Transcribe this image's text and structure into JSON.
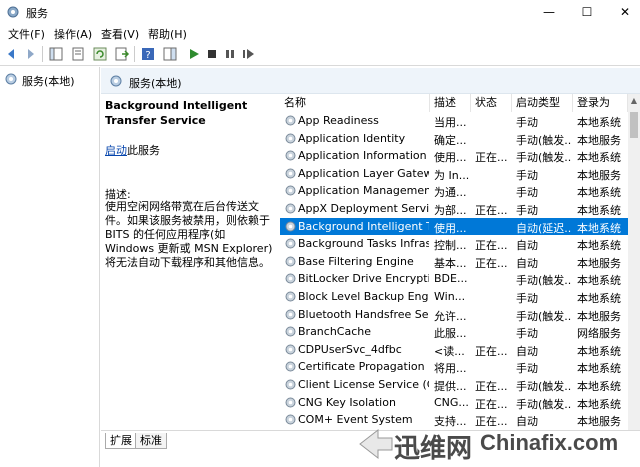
{
  "window": {
    "title": "服务",
    "minimize": "—",
    "maximize": "☐",
    "close": "✕"
  },
  "menu": [
    "文件(F)",
    "操作(A)",
    "查看(V)",
    "帮助(H)"
  ],
  "tree": {
    "root_label": "服务(本地)"
  },
  "pane": {
    "header": "服务(本地)"
  },
  "description": {
    "service_name": "Background Intelligent Transfer Service",
    "start_link": "启动",
    "start_suffix": "此服务",
    "label": "描述:",
    "text": "使用空闲网络带宽在后台传送文件。如果该服务被禁用，则依赖于 BITS 的任何应用程序(如 Windows 更新或 MSN Explorer)将无法自动下载程序和其他信息。"
  },
  "columns": [
    "名称",
    "描述",
    "状态",
    "启动类型",
    "登录为"
  ],
  "services": [
    {
      "name": "App Readiness",
      "desc": "当用...",
      "status": "",
      "startup": "手动",
      "logon": "本地系统"
    },
    {
      "name": "Application Identity",
      "desc": "确定...",
      "status": "",
      "startup": "手动(触发...",
      "logon": "本地服务"
    },
    {
      "name": "Application Information",
      "desc": "使用...",
      "status": "正在...",
      "startup": "手动(触发...",
      "logon": "本地系统"
    },
    {
      "name": "Application Layer Gatewa...",
      "desc": "为 In...",
      "status": "",
      "startup": "手动",
      "logon": "本地服务"
    },
    {
      "name": "Application Management",
      "desc": "为通...",
      "status": "",
      "startup": "手动",
      "logon": "本地系统"
    },
    {
      "name": "AppX Deployment Servic...",
      "desc": "为部...",
      "status": "正在...",
      "startup": "手动",
      "logon": "本地系统"
    },
    {
      "name": "Background Intelligent T...",
      "desc": "使用...",
      "status": "",
      "startup": "自动(延迟...",
      "logon": "本地系统"
    },
    {
      "name": "Background Tasks Infras...",
      "desc": "控制...",
      "status": "正在...",
      "startup": "自动",
      "logon": "本地系统"
    },
    {
      "name": "Base Filtering Engine",
      "desc": "基本...",
      "status": "正在...",
      "startup": "自动",
      "logon": "本地服务"
    },
    {
      "name": "BitLocker Drive Encryptio...",
      "desc": "BDE...",
      "status": "",
      "startup": "手动(触发...",
      "logon": "本地系统"
    },
    {
      "name": "Block Level Backup Engi...",
      "desc": "Win...",
      "status": "",
      "startup": "手动",
      "logon": "本地系统"
    },
    {
      "name": "Bluetooth Handsfree Ser...",
      "desc": "允许...",
      "status": "",
      "startup": "手动(触发...",
      "logon": "本地服务"
    },
    {
      "name": "BranchCache",
      "desc": "此服...",
      "status": "",
      "startup": "手动",
      "logon": "网络服务"
    },
    {
      "name": "CDPUserSvc_4dfbc",
      "desc": "<读...",
      "status": "正在...",
      "startup": "自动",
      "logon": "本地系统"
    },
    {
      "name": "Certificate Propagation",
      "desc": "将用...",
      "status": "",
      "startup": "手动",
      "logon": "本地系统"
    },
    {
      "name": "Client License Service (Cli...",
      "desc": "提供...",
      "status": "正在...",
      "startup": "手动(触发...",
      "logon": "本地系统"
    },
    {
      "name": "CNG Key Isolation",
      "desc": "CNG...",
      "status": "正在...",
      "startup": "手动(触发...",
      "logon": "本地系统"
    },
    {
      "name": "COM+ Event System",
      "desc": "支持...",
      "status": "正在...",
      "startup": "自动",
      "logon": "本地服务"
    }
  ],
  "selected_index": 6,
  "tabs": [
    "扩展",
    "标准"
  ],
  "watermark": {
    "cn": "迅维网",
    "en": "Chinafix.com"
  },
  "colors": {
    "selection": "#0078d7",
    "header_bg": "#eef4fa",
    "link": "#0645ad"
  }
}
